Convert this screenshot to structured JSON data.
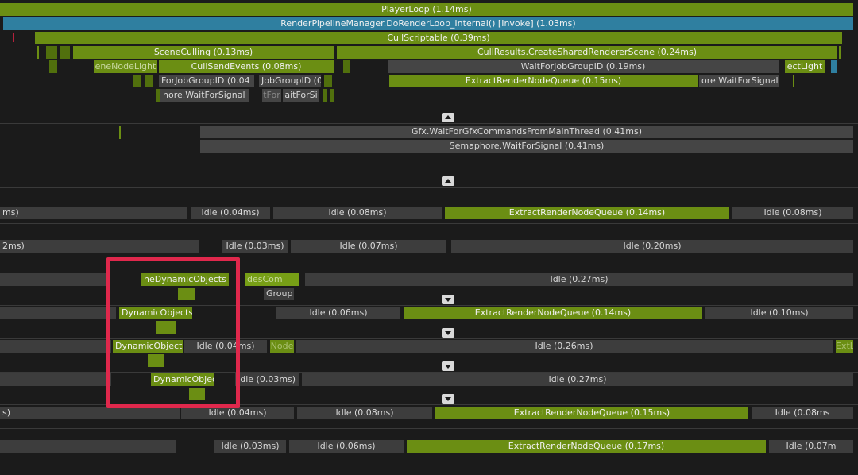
{
  "main_thread": {
    "row0": {
      "player_loop": "PlayerLoop (1.14ms)"
    },
    "row1": {
      "render_pipeline": "RenderPipelineManager.DoRenderLoop_Internal() [Invoke] (1.03ms)"
    },
    "row2": {
      "cull_scriptable": "CullScriptable (0.39ms)"
    },
    "row3": {
      "scene_culling": "SceneCulling (0.13ms)",
      "cull_results": "CullResults.CreateSharedRendererScene (0.24ms)"
    },
    "row4": {
      "scene_node_light": "eneNodeLight",
      "cull_send_events": "CullSendEvents (0.08ms)",
      "wait_job_group": "WaitForJobGroupID (0.19ms)",
      "ect_light": "ectLight"
    },
    "row5": {
      "for_job_group": "ForJobGroupID (0.04",
      "job_group": "JobGroupID (0",
      "extract_render": "ExtractRenderNodeQueue (0.15ms)",
      "semaphore_wait": "ore.WaitForSignal ("
    },
    "row6": {
      "semaphore_short": "nore.WaitForSignal (0",
      "tfo": "tFor",
      "wait_for_si": "aitForSi"
    }
  },
  "render_thread": {
    "gfx_wait": "Gfx.WaitForGfxCommandsFromMainThread (0.41ms)",
    "semaphore": "Semaphore.WaitForSignal (0.41ms)"
  },
  "workers": {
    "w1": {
      "a": "ms)",
      "b": "Idle (0.04ms)",
      "c": "Idle (0.08ms)",
      "d": "ExtractRenderNodeQueue (0.14ms)",
      "e": "Idle (0.08ms)"
    },
    "w2": {
      "a": "2ms)",
      "b": "Idle (0.03ms)",
      "c": "Idle (0.07ms)",
      "d": "Idle (0.20ms)"
    },
    "w3": {
      "a": "neDynamicObjects (",
      "b": "desCom",
      "c": "Idle (0.27ms)",
      "d": "Group"
    },
    "w4": {
      "a": "DynamicObjects",
      "b": "Idle (0.06ms)",
      "c": "ExtractRenderNodeQueue (0.14ms)",
      "d": "Idle (0.10ms)"
    },
    "w5": {
      "a": "DynamicObjects",
      "b": "Idle (0.04ms)",
      "c": "Node",
      "d": "Idle (0.26ms)",
      "e": "ExtL"
    },
    "w6": {
      "a": "DynamicObject",
      "b": "Idle (0.03ms)",
      "c": "Idle (0.27ms)"
    },
    "w7": {
      "a": "s)",
      "b": "Idle (0.04ms)",
      "c": "Idle (0.08ms)",
      "d": "ExtractRenderNodeQueue (0.15ms)",
      "e": "Idle (0.08ms"
    },
    "w8": {
      "a": "Idle (0.03ms)",
      "b": "Idle (0.06ms)",
      "c": "ExtractRenderNodeQueue (0.17ms)",
      "d": "Idle (0.07m"
    }
  },
  "colors": {
    "marker_idle": "#3d3d3d",
    "marker_job": "#6b8e13",
    "marker_render": "#2f7fa0",
    "highlight": "#e0284c"
  }
}
